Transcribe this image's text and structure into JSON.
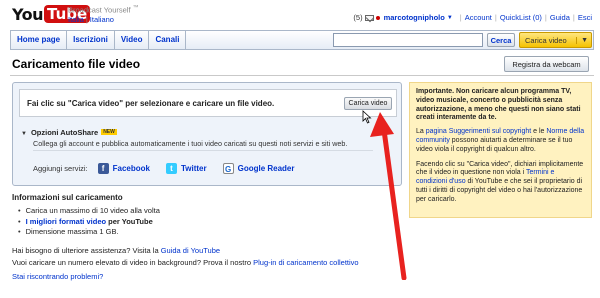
{
  "header": {
    "logo_you": "You",
    "logo_tube": "Tube",
    "tagline": "Broadcast Yourself",
    "trademark": "™",
    "lang_current": "Italia",
    "lang_name": "Italiano",
    "message_count": "(5)",
    "username": "marcotognipholo",
    "links": [
      "Account",
      "QuickList (0)",
      "Guida",
      "Esci"
    ]
  },
  "nav": {
    "tabs": [
      "Home page",
      "Iscrizioni",
      "Video",
      "Canali"
    ],
    "search_value": "",
    "search_button": "Cerca",
    "upload_button": "Carica video"
  },
  "page": {
    "title": "Caricamento file video",
    "webcam_button": "Registra da webcam"
  },
  "upload": {
    "instruction": "Fai clic su \"Carica video\" per selezionare e caricare un file video.",
    "choose_button": "Carica video",
    "autoshare_title": "Opzioni AutoShare",
    "new_badge": "NEW",
    "autoshare_desc": "Collega gli account e pubblica automaticamente i tuoi video caricati su questi noti servizi e siti web.",
    "services_label": "Aggiungi servizi:",
    "services": [
      "Facebook",
      "Twitter",
      "Google Reader"
    ]
  },
  "warning": {
    "heading": "Importante. Non caricare alcun programma TV, video musicale, concerto o pubblicità senza autorizzazione, a meno che questi non siano stati creati interamente da te.",
    "p1_a": "La ",
    "p1_link1": "pagina Suggerimenti sul copyright",
    "p1_b": " e le ",
    "p1_link2": "Norme della community",
    "p1_c": " possono aiutarti a determinare se il tuo video viola il copyright di qualcun altro.",
    "p2_a": "Facendo clic su \"Carica video\", dichiari implicitamente che il video in questione non viola i ",
    "p2_link": "Termini e condizioni d'uso",
    "p2_b": " di YouTube e che sei il proprietario di tutti i diritti di copyright del video o hai l'autorizzazione per caricarlo."
  },
  "info": {
    "title": "Informazioni sul caricamento",
    "item1": "Carica un massimo di 10 video alla volta",
    "item2_link": "I migliori formati video",
    "item2_rest": " per YouTube",
    "item3": "Dimensione massima 1 GB.",
    "help1_text": "Hai bisogno di ulteriore assistenza? Visita la ",
    "help1_link": "Guida di YouTube",
    "help2_text": "Vuoi caricare un numero elevato di video in background? Prova il nostro ",
    "help2_link": "Plug-in di caricamento collettivo",
    "problems_link": "Stai riscontrando problemi?"
  },
  "colors": {
    "brand_red": "#d10f0f",
    "link_blue": "#0033cc",
    "upload_yellow": "#f5c200",
    "warning_bg": "#fff2c0",
    "arrow_red": "#e8221f"
  },
  "icons": [
    "mail-icon",
    "chevron-down-icon",
    "cursor-icon",
    "facebook-icon",
    "twitter-icon",
    "google-reader-icon",
    "red-arrow-icon"
  ]
}
